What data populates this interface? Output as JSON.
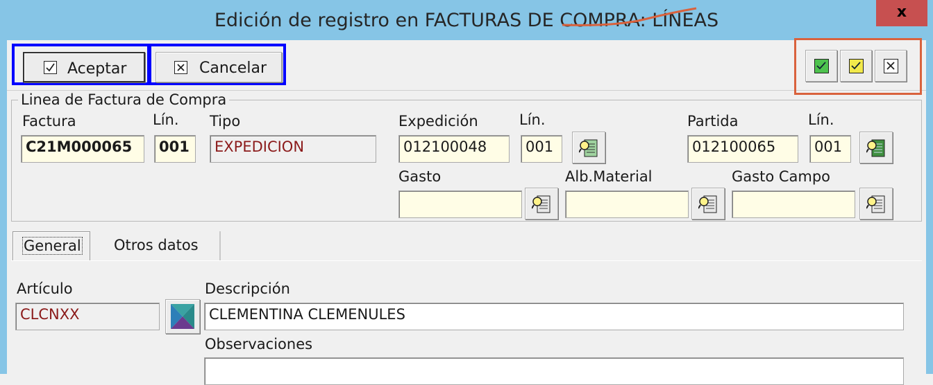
{
  "window": {
    "title": "Edición de registro en FACTURAS DE COMPRA: LÍNEAS",
    "close_label": "x",
    "accent_title_bar": "#86c5e6",
    "close_color": "#c75050"
  },
  "toolbar": {
    "accept_label": "Aceptar",
    "cancel_label": "Cancelar",
    "quick_actions": [
      {
        "icon": "green-check-icon",
        "color": "#4ec24e"
      },
      {
        "icon": "yellow-check-icon",
        "color": "#f2e94b"
      },
      {
        "icon": "close-box-icon",
        "color": "#ffffff"
      }
    ],
    "main_highlight_color": "#0000ff",
    "quick_highlight_color": "#d9623d"
  },
  "group": {
    "title": "Linea de Factura de Compra",
    "fields": {
      "factura": {
        "label": "Factura",
        "value": "C21M000065"
      },
      "lin1": {
        "label": "Lín.",
        "value": "001"
      },
      "tipo": {
        "label": "Tipo",
        "value": "EXPEDICION"
      },
      "expedicion": {
        "label": "Expedición",
        "value": "012100048"
      },
      "lin2": {
        "label": "Lín.",
        "value": "001"
      },
      "partida": {
        "label": "Partida",
        "value": "012100065"
      },
      "lin3": {
        "label": "Lín.",
        "value": "001"
      },
      "gasto": {
        "label": "Gasto",
        "value": ""
      },
      "alb_material": {
        "label": "Alb.Material",
        "value": ""
      },
      "gasto_campo": {
        "label": "Gasto Campo",
        "value": ""
      }
    }
  },
  "tabs": [
    {
      "label": "General",
      "active": true
    },
    {
      "label": "Otros datos",
      "active": false
    }
  ],
  "general": {
    "articulo": {
      "label": "Artículo",
      "value": "CLCNXX"
    },
    "descripcion": {
      "label": "Descripción",
      "value": "CLEMENTINA CLEMENULES"
    },
    "observaciones": {
      "label": "Observaciones",
      "value": ""
    }
  }
}
